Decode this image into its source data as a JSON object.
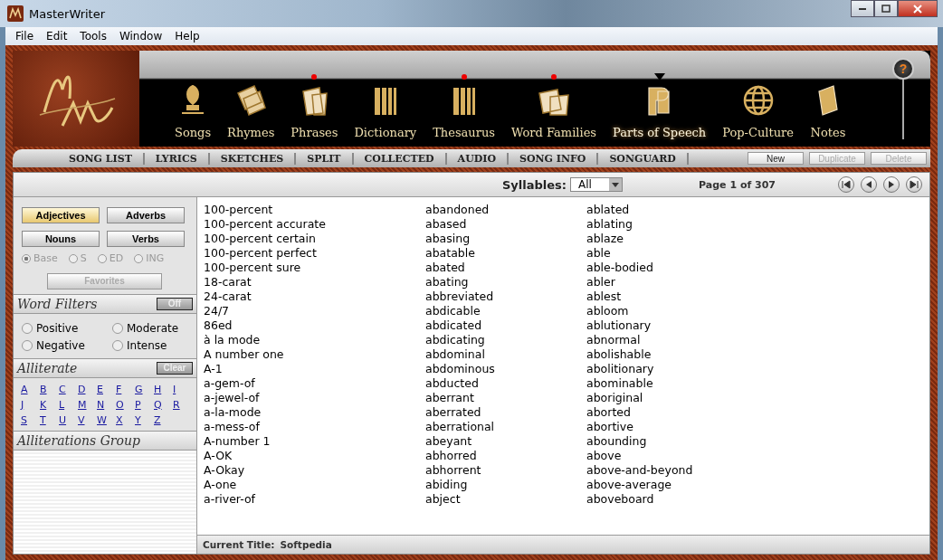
{
  "window": {
    "title": "MasterWriter"
  },
  "menu": [
    "File",
    "Edit",
    "Tools",
    "Window",
    "Help"
  ],
  "nav": [
    {
      "label": "Songs",
      "selected": false,
      "flagged": false
    },
    {
      "label": "Rhymes",
      "selected": false,
      "flagged": false
    },
    {
      "label": "Phrases",
      "selected": false,
      "flagged": true
    },
    {
      "label": "Dictionary",
      "selected": false,
      "flagged": false
    },
    {
      "label": "Thesaurus",
      "selected": false,
      "flagged": true
    },
    {
      "label": "Word Families",
      "selected": false,
      "flagged": true
    },
    {
      "label": "Parts of Speech",
      "selected": true,
      "flagged": false
    },
    {
      "label": "Pop-Culture",
      "selected": false,
      "flagged": false
    },
    {
      "label": "Notes",
      "selected": false,
      "flagged": false
    }
  ],
  "help": {
    "label": "?"
  },
  "tabs": [
    "SONG LIST",
    "LYRICS",
    "SKETCHES",
    "SPLIT",
    "COLLECTED",
    "AUDIO",
    "SONG INFO",
    "SONGUARD"
  ],
  "actions": [
    {
      "label": "New",
      "disabled": false
    },
    {
      "label": "Duplicate",
      "disabled": true
    },
    {
      "label": "Delete",
      "disabled": true
    }
  ],
  "toolbar": {
    "syllables_label": "Syllables:",
    "syllables_value": "All",
    "page": "Page 1 of 307"
  },
  "pos_buttons": [
    {
      "label": "Adjectives",
      "selected": true
    },
    {
      "label": "Adverbs",
      "selected": false
    },
    {
      "label": "Nouns",
      "selected": false
    },
    {
      "label": "Verbs",
      "selected": false
    }
  ],
  "forms": [
    {
      "label": "Base",
      "selected": true,
      "disabled": true
    },
    {
      "label": "S",
      "selected": false,
      "disabled": true
    },
    {
      "label": "ED",
      "selected": false,
      "disabled": true
    },
    {
      "label": "ING",
      "selected": false,
      "disabled": true
    }
  ],
  "favorites": {
    "label": "Favorites",
    "disabled": true
  },
  "word_filters": {
    "title": "Word Filters",
    "toggle": {
      "label": "Off",
      "disabled": true
    },
    "options": [
      {
        "label": "Positive",
        "selected": false
      },
      {
        "label": "Moderate",
        "selected": false
      },
      {
        "label": "Negative",
        "selected": false
      },
      {
        "label": "Intense",
        "selected": false
      }
    ]
  },
  "alliterate": {
    "title": "Alliterate",
    "clear": {
      "label": "Clear",
      "disabled": true
    },
    "letters": [
      "A",
      "B",
      "C",
      "D",
      "E",
      "F",
      "G",
      "H",
      "I",
      "J",
      "K",
      "L",
      "M",
      "N",
      "O",
      "P",
      "Q",
      "R",
      "S",
      "T",
      "U",
      "V",
      "W",
      "X",
      "Y",
      "Z"
    ]
  },
  "alliterations_group": {
    "title": "Alliterations Group"
  },
  "words": [
    [
      "100-percent",
      "100-percent accurate",
      "100-percent certain",
      "100-percent perfect",
      "100-percent sure",
      "18-carat",
      "24-carat",
      "24/7",
      "86ed",
      "à la mode",
      "A number one",
      "A-1",
      "a-gem-of",
      "a-jewel-of",
      "a-la-mode",
      "a-mess-of",
      "A-number 1",
      "A-OK",
      "A-Okay",
      "A-one",
      "a-river-of"
    ],
    [
      "abandoned",
      "abased",
      "abasing",
      "abatable",
      "abated",
      "abating",
      "abbreviated",
      "abdicable",
      "abdicated",
      "abdicating",
      "abdominal",
      "abdominous",
      "abducted",
      "aberrant",
      "aberrated",
      "aberrational",
      "abeyant",
      "abhorred",
      "abhorrent",
      "abiding",
      "abject"
    ],
    [
      "ablated",
      "ablating",
      "ablaze",
      "able",
      "able-bodied",
      "abler",
      "ablest",
      "abloom",
      "ablutionary",
      "abnormal",
      "abolishable",
      "abolitionary",
      "abominable",
      "aboriginal",
      "aborted",
      "abortive",
      "abounding",
      "above",
      "above-and-beyond",
      "above-average",
      "aboveboard"
    ]
  ],
  "status": {
    "label": "Current Title:",
    "value": "Softpedia"
  }
}
